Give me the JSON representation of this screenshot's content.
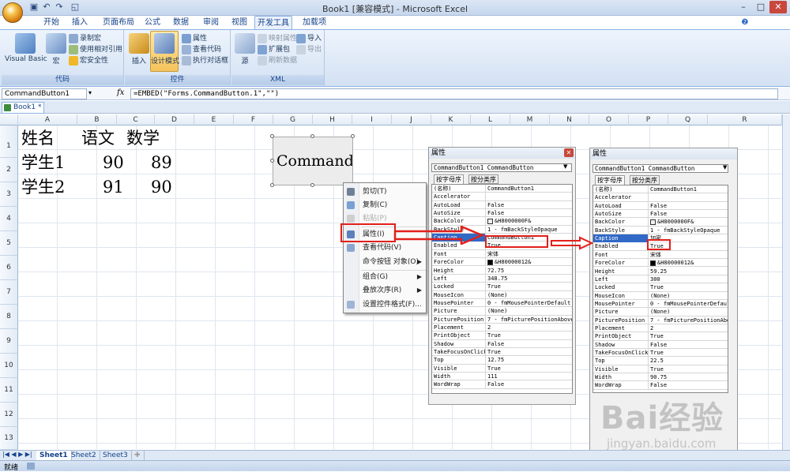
{
  "window": {
    "title": "Book1  [兼容模式] - Microsoft Excel",
    "qat": [
      "save-icon",
      "undo-icon",
      "redo-icon",
      "print-preview-icon"
    ],
    "controls": [
      "minimize",
      "maximize",
      "close"
    ]
  },
  "ribbon": {
    "tabs": [
      "开始",
      "插入",
      "页面布局",
      "公式",
      "数据",
      "审阅",
      "视图",
      "开发工具",
      "加载项"
    ],
    "active_tab": "开发工具",
    "groups": {
      "code": {
        "label": "代码",
        "visual_basic": "Visual Basic",
        "macros": "宏",
        "record_macro": "录制宏",
        "relative_refs": "使用相对引用",
        "macro_security": "宏安全性"
      },
      "controls": {
        "label": "控件",
        "insert": "插入",
        "design_mode": "设计模式",
        "properties": "属性",
        "view_code": "查看代码",
        "run_dialog": "执行对话框"
      },
      "xml": {
        "label": "XML",
        "source": "源",
        "map_properties": "映射属性",
        "expansion_packs": "扩展包",
        "refresh_data": "刷新数据",
        "import": "导入",
        "export": "导出"
      }
    }
  },
  "formula_bar": {
    "name_box": "CommandButton1",
    "fx": "fx",
    "formula": "=EMBED(\"Forms.CommandButton.1\",\"\")"
  },
  "workbook_tab": "Book1 *",
  "columns": [
    "A",
    "B",
    "C",
    "D",
    "E",
    "F",
    "G",
    "H",
    "I",
    "J",
    "K",
    "L",
    "M",
    "N",
    "O",
    "P",
    "Q",
    "R"
  ],
  "rows": [
    "1",
    "2",
    "3",
    "4",
    "5",
    "6",
    "7",
    "8",
    "9",
    "10",
    "11",
    "12",
    "13"
  ],
  "cells": {
    "A1": "姓名",
    "B1": "语文",
    "C1": "数学",
    "A2": "学生1",
    "B2": "90",
    "C2": "89",
    "A3": "学生2",
    "B3": "91",
    "C3": "90"
  },
  "command_button": {
    "caption": "CommandButton1"
  },
  "context_menu": {
    "items": [
      {
        "label": "剪切(T)",
        "icon": "scissors-icon",
        "disabled": false,
        "submenu": false
      },
      {
        "label": "复制(C)",
        "icon": "copy-icon",
        "disabled": false,
        "submenu": false
      },
      {
        "label": "粘贴(P)",
        "icon": "paste-icon",
        "disabled": true,
        "submenu": false
      },
      {
        "label": "属性(I)",
        "icon": "properties-icon",
        "disabled": false,
        "submenu": false
      },
      {
        "label": "查看代码(V)",
        "icon": "view-code-icon",
        "disabled": false,
        "submenu": false
      },
      {
        "label": "命令按钮 对象(O)",
        "icon": "",
        "disabled": false,
        "submenu": true
      },
      {
        "label": "组合(G)",
        "icon": "",
        "disabled": false,
        "submenu": true
      },
      {
        "label": "叠放次序(R)",
        "icon": "",
        "disabled": false,
        "submenu": true
      },
      {
        "label": "设置控件格式(F)...",
        "icon": "format-control-icon",
        "disabled": false,
        "submenu": false
      }
    ]
  },
  "properties_before": {
    "title": "属性",
    "object": "CommandButton1 CommandButton",
    "tabs": [
      "按字母序",
      "按分类序"
    ],
    "rows": [
      [
        "(名称)",
        "CommandButton1"
      ],
      [
        "Accelerator",
        ""
      ],
      [
        "AutoLoad",
        "False"
      ],
      [
        "AutoSize",
        "False"
      ],
      [
        "BackColor",
        "&H8000000F&"
      ],
      [
        "BackStyle",
        "1 - fmBackStyleOpaque"
      ],
      [
        "Caption",
        "CommandButton1"
      ],
      [
        "Enabled",
        "True"
      ],
      [
        "Font",
        "宋体"
      ],
      [
        "ForeColor",
        "&H80000012&"
      ],
      [
        "Height",
        "72.75"
      ],
      [
        "Left",
        "348.75"
      ],
      [
        "Locked",
        "True"
      ],
      [
        "MouseIcon",
        "(None)"
      ],
      [
        "MousePointer",
        "0 - fmMousePointerDefault"
      ],
      [
        "Picture",
        "(None)"
      ],
      [
        "PicturePosition",
        "7 - fmPicturePositionAbove"
      ],
      [
        "Placement",
        "2"
      ],
      [
        "PrintObject",
        "True"
      ],
      [
        "Shadow",
        "False"
      ],
      [
        "TakeFocusOnClick",
        "True"
      ],
      [
        "Top",
        "12.75"
      ],
      [
        "Visible",
        "True"
      ],
      [
        "Width",
        "111"
      ],
      [
        "WordWrap",
        "False"
      ]
    ]
  },
  "properties_after": {
    "title": "属性",
    "object": "CommandButton1 CommandButton",
    "tabs": [
      "按字母序",
      "按分类序"
    ],
    "rows": [
      [
        "(名称)",
        "CommandButton1"
      ],
      [
        "Accelerator",
        ""
      ],
      [
        "AutoLoad",
        "False"
      ],
      [
        "AutoSize",
        "False"
      ],
      [
        "BackColor",
        "&H8000000F&"
      ],
      [
        "BackStyle",
        "1 - fmBackStyleOpaque"
      ],
      [
        "Caption",
        "加密"
      ],
      [
        "Enabled",
        "True"
      ],
      [
        "Font",
        "宋体"
      ],
      [
        "ForeColor",
        "&H80000012&"
      ],
      [
        "Height",
        "59.25"
      ],
      [
        "Left",
        "300"
      ],
      [
        "Locked",
        "True"
      ],
      [
        "MouseIcon",
        "(None)"
      ],
      [
        "MousePointer",
        "0 - fmMousePointerDefault"
      ],
      [
        "Picture",
        "(None)"
      ],
      [
        "PicturePosition",
        "7 - fmPicturePositionAbove"
      ],
      [
        "Placement",
        "2"
      ],
      [
        "PrintObject",
        "True"
      ],
      [
        "Shadow",
        "False"
      ],
      [
        "TakeFocusOnClick",
        "True"
      ],
      [
        "Top",
        "22.5"
      ],
      [
        "Visible",
        "True"
      ],
      [
        "Width",
        "90.75"
      ],
      [
        "WordWrap",
        "False"
      ]
    ]
  },
  "sheets": [
    "Sheet1",
    "Sheet2",
    "Sheet3"
  ],
  "status": {
    "ready": "就绪"
  },
  "watermark": {
    "brand": "Bai经验",
    "url": "jingyan.baidu.com"
  },
  "colors": {
    "highlight": "#e2201b",
    "selected_row": "#3169c6",
    "ribbon_text": "#15428b"
  }
}
